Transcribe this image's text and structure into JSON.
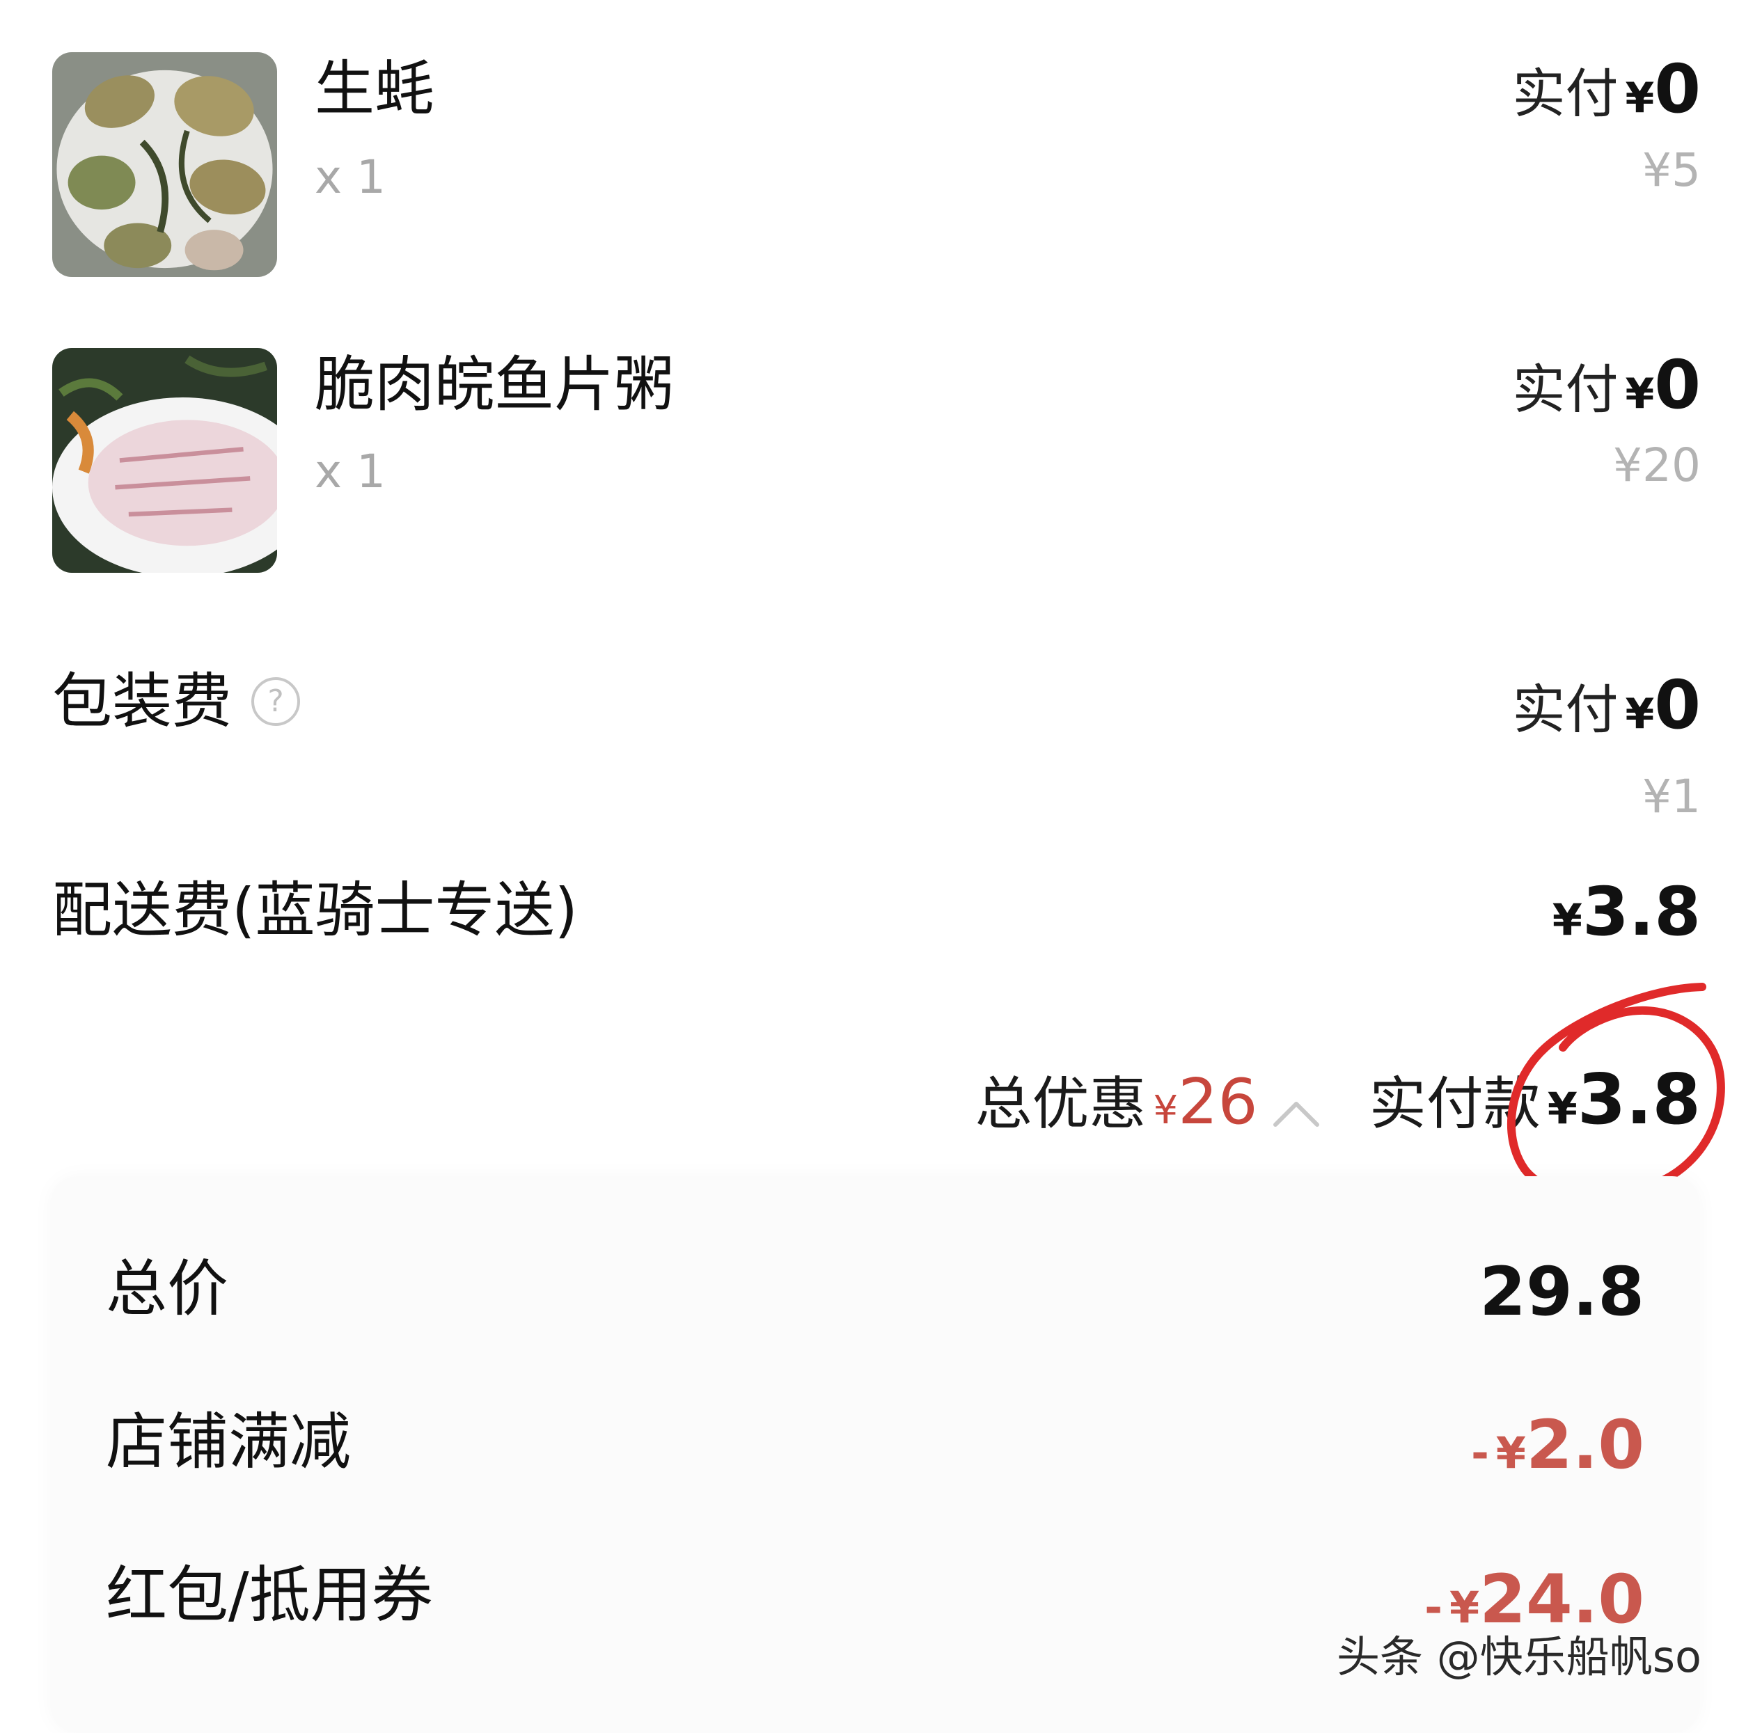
{
  "items": [
    {
      "name": "生蚝",
      "qty": "x 1",
      "paid_label": "实付",
      "paid_currency": "¥",
      "paid_amount": "0",
      "original_price": "¥5",
      "image_icon": "oyster-photo"
    },
    {
      "name": "脆肉皖鱼片粥",
      "qty": "x 1",
      "paid_label": "实付",
      "paid_currency": "¥",
      "paid_amount": "0",
      "original_price": "¥20",
      "image_icon": "fish-slices-photo"
    }
  ],
  "packaging": {
    "label": "包装费",
    "help_glyph": "?",
    "paid_label": "实付",
    "paid_currency": "¥",
    "paid_amount": "0",
    "original_price": "¥1"
  },
  "delivery": {
    "label": "配送费(蓝骑士专送)",
    "currency": "¥",
    "amount": "3.8"
  },
  "summary": {
    "discount_label": "总优惠",
    "discount_currency": "¥",
    "discount_amount": "26",
    "pay_label": "实付款",
    "pay_currency": "¥",
    "pay_amount": "3.8"
  },
  "breakdown": {
    "total_label": "总价",
    "total_value": "29.8",
    "store_discount_label": "店铺满减",
    "store_discount_sign": "-",
    "store_discount_currency": "¥",
    "store_discount_amount": "2.0",
    "coupon_label": "红包/抵用券",
    "coupon_sign": "-",
    "coupon_currency": "¥",
    "coupon_amount": "24.0"
  },
  "watermark": "头条 @快乐船帆so",
  "colors": {
    "discount_red": "#c7463c",
    "annotation_red": "#e02a2a",
    "muted_gray": "#b3b3b3"
  }
}
